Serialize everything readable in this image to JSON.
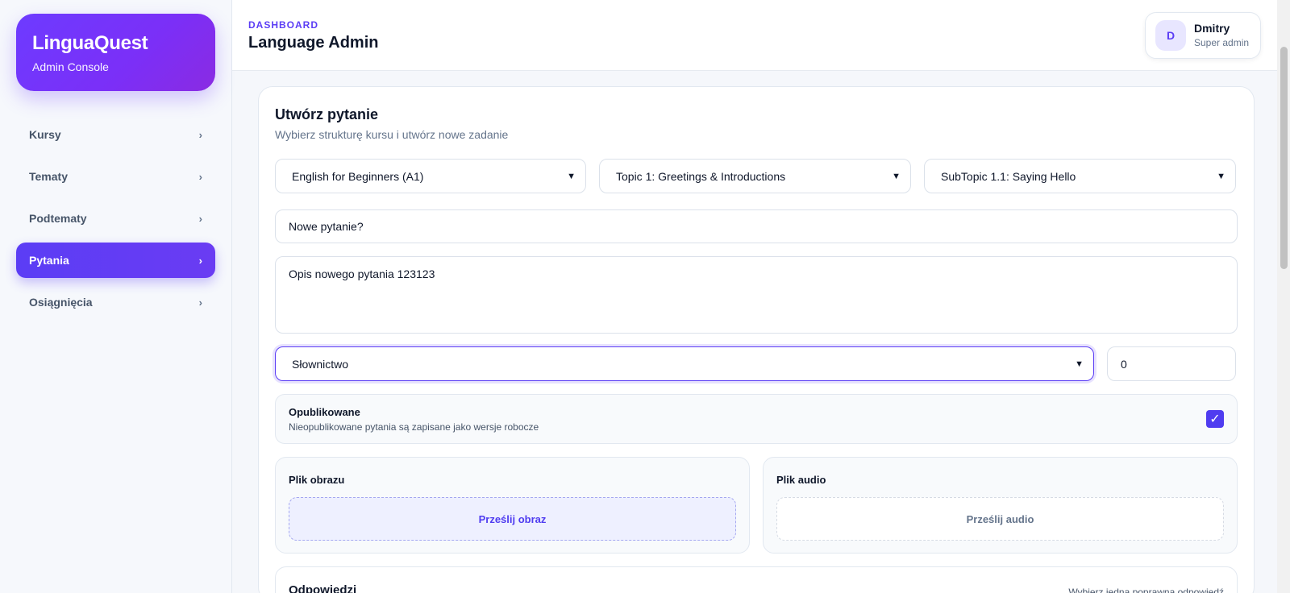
{
  "brand": {
    "title": "LinguaQuest",
    "subtitle": "Admin Console"
  },
  "sidebar": {
    "items": [
      {
        "label": "Kursy",
        "active": false
      },
      {
        "label": "Tematy",
        "active": false
      },
      {
        "label": "Podtematy",
        "active": false
      },
      {
        "label": "Pytania",
        "active": true
      },
      {
        "label": "Osiągnięcia",
        "active": false
      }
    ],
    "chevron": "›"
  },
  "header": {
    "breadcrumb": "DASHBOARD",
    "title": "Language Admin",
    "user": {
      "initial": "D",
      "name": "Dmitry",
      "role": "Super admin"
    }
  },
  "form": {
    "title": "Utwórz pytanie",
    "subtitle": "Wybierz strukturę kursu i utwórz nowe zadanie",
    "course": "English for Beginners (A1)",
    "topic": "Topic 1: Greetings & Introductions",
    "subtopic": "SubTopic 1.1: Saying Hello",
    "question_title": "Nowe pytanie?",
    "description": "Opis nowego pytania 123123",
    "type": "Słownictwo",
    "order": "0",
    "published": {
      "label": "Opublikowane",
      "hint": "Nieopublikowane pytania są zapisane jako wersje robocze",
      "checked": true
    },
    "image_upload": {
      "label": "Plik obrazu",
      "button": "Prześlij obraz"
    },
    "audio_upload": {
      "label": "Plik audio",
      "button": "Prześlij audio"
    },
    "answers": {
      "title": "Odpowiedzi",
      "hint": "Wybierz jedną poprawną odpowiedź"
    }
  },
  "colors": {
    "accent": "#5b3df5",
    "brand_gradient_start": "#6d3bff",
    "brand_gradient_end": "#8a2be2"
  }
}
